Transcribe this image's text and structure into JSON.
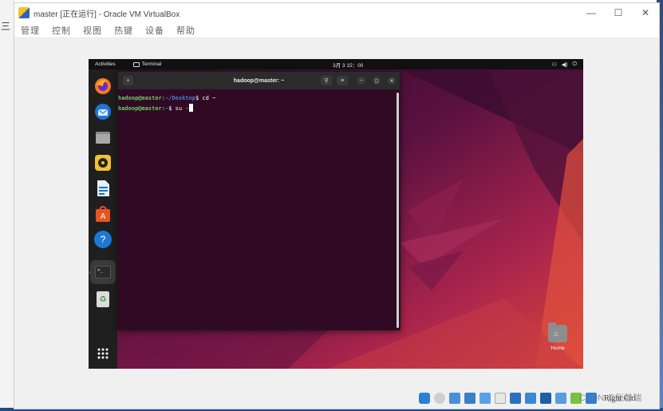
{
  "vbox": {
    "title": "master [正在运行] - Oracle VM VirtualBox",
    "controls": {
      "minimize": "—",
      "maximize": "☐",
      "close": "✕"
    },
    "menu": [
      "管理",
      "控制",
      "视图",
      "热键",
      "设备",
      "帮助"
    ]
  },
  "host": {
    "left_glyph": "三"
  },
  "guest": {
    "topbar": {
      "activities": "Activities",
      "app": "Terminal",
      "clock": "3月 3 15：00",
      "tray": [
        "⚇",
        "◀)",
        "⏻"
      ]
    },
    "dock": {
      "items": [
        "firefox-icon",
        "thunderbird-icon",
        "files-icon",
        "rhythmbox-icon",
        "writer-icon",
        "app-center-icon",
        "help-icon",
        "terminal-icon",
        "trash-icon",
        "show-apps-icon"
      ],
      "help_glyph": "?",
      "terminal_glyph": ">_",
      "apps_glyph": "⋮⋮⋮",
      "trash_glyph": "♻"
    },
    "terminal": {
      "title": "hadoop@master: ~",
      "new_tab": "+",
      "search": "⚲",
      "menu": "≡",
      "minimize": "–",
      "maximize": "◻",
      "close": "✕",
      "lines": [
        {
          "user": "hadoop@master",
          "path": "~/Desktop",
          "command": "$ cd ~"
        },
        {
          "user": "hadoop@master",
          "path": "~",
          "command": "$ su -"
        }
      ]
    },
    "desktop": {
      "home_label": "Home",
      "home_glyph": "⌂"
    }
  },
  "statusbar": {
    "host_key": "Right Ctrl",
    "watermark": "CSDN @张静瑞"
  }
}
